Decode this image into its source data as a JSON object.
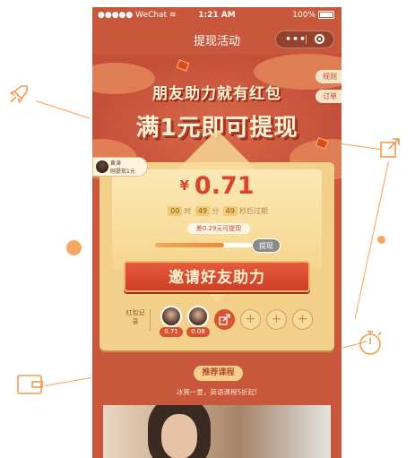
{
  "status_bar": {
    "carrier": "WeChat",
    "time": "1:21 AM",
    "battery": "100%"
  },
  "nav": {
    "title": "提现活动"
  },
  "hero": {
    "slogan_line1": "朋友助力就有红包",
    "slogan_line2": "满1元即可提现",
    "side_buttons": {
      "rules": "规则",
      "orders": "订单"
    }
  },
  "helper_notice": {
    "name": "黄涛",
    "text": "刚提现1元"
  },
  "reward": {
    "currency": "¥",
    "amount": "0.71",
    "countdown": {
      "hours": "00",
      "hour_unit": "时",
      "minutes": "49",
      "minute_unit": "分",
      "seconds": "49",
      "seconds_suffix": "秒后过期"
    },
    "difference_text": "差0.29元可提现",
    "progress_fraction": 0.71,
    "withdraw_button": "提现",
    "invite_button": "邀请好友助力"
  },
  "records": {
    "label": "红包记录",
    "helpers": [
      {
        "amount": "0.71"
      },
      {
        "amount": "0.08"
      }
    ],
    "empty_slot_symbol": "+",
    "share_icon": "share-icon"
  },
  "courses": {
    "tag": "推荐课程",
    "subtitle": "冰爽一夏，英语课程5折起!"
  },
  "colors": {
    "primary": "#c9573b",
    "gold": "#f3d089",
    "accent_red": "#d9442a",
    "deco_orange": "#f19a4e"
  }
}
